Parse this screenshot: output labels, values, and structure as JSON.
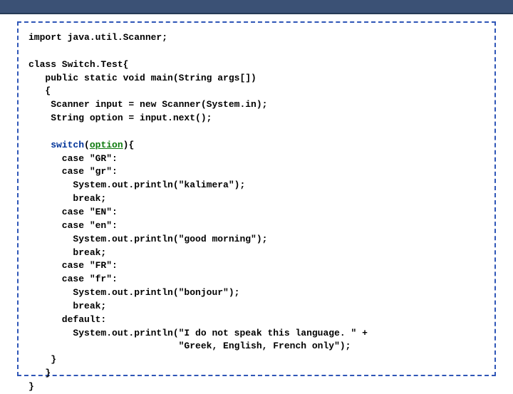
{
  "code": {
    "l01": "import java.util.Scanner;",
    "l02": "",
    "l03": "class Switch.Test{",
    "l04": "   public static void main(String args[])",
    "l05": "   {",
    "l06": "    Scanner input = new Scanner(System.in);",
    "l07": "    String option = input.next();",
    "l08": "",
    "l09a": "    ",
    "l09b": "switch",
    "l09c": "(",
    "l09d": "option",
    "l09e": "){",
    "l10": "      case \"GR\":",
    "l11": "      case \"gr\":",
    "l12": "        System.out.println(\"kalimera\");",
    "l13": "        break;",
    "l14": "      case \"EN\":",
    "l15": "      case \"en\":",
    "l16": "        System.out.println(\"good morning\");",
    "l17": "        break;",
    "l18": "      case \"FR\":",
    "l19": "      case \"fr\":",
    "l20": "        System.out.println(\"bonjour\");",
    "l21": "        break;",
    "l22": "      default:",
    "l23": "        System.out.println(\"I do not speak this language. \" +",
    "l24": "                           \"Greek, English, French only\");",
    "l25": "    }",
    "l26": "   }",
    "l27": "}"
  }
}
